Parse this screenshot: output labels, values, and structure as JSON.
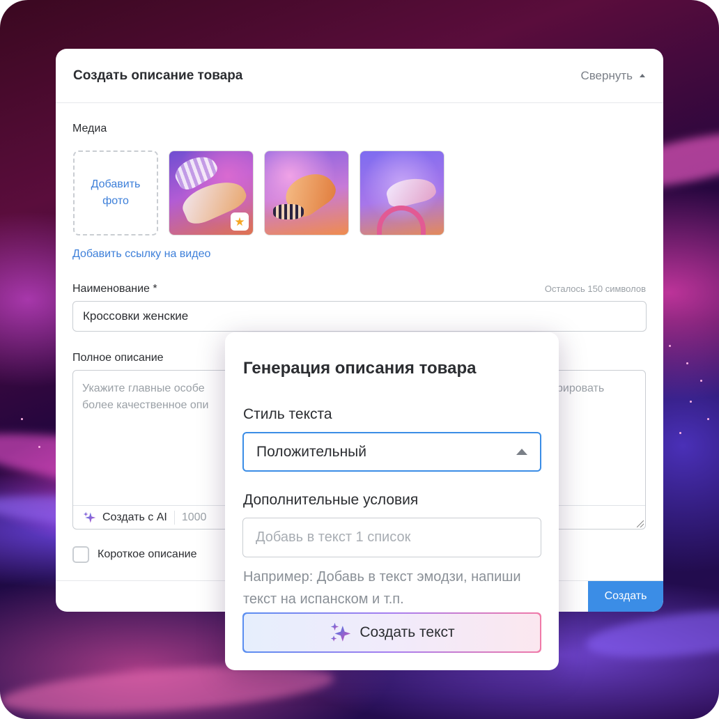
{
  "card": {
    "title": "Создать описание товара",
    "collapse_label": "Свернуть"
  },
  "media": {
    "label": "Медиа",
    "add_photo": "Добавить фото",
    "add_video_link": "Добавить ссылку на видео"
  },
  "name_field": {
    "label": "Наименование *",
    "counter": "Осталось 150 символов",
    "value": "Кроссовки женские"
  },
  "description": {
    "label": "Полное описание",
    "placeholder": "Укажите главные особе",
    "placeholder_line2": "более качественное опи",
    "placeholder_tail": "рировать",
    "ai_button": "Создать с AI",
    "char_count": "1000"
  },
  "short_description": {
    "label": "Короткое описание"
  },
  "submit_label": "Создать",
  "popup": {
    "title": "Генерация описания товара",
    "style_label": "Стиль текста",
    "style_value": "Положительный",
    "conditions_label": "Дополнительные условия",
    "conditions_placeholder": "Добавь в текст 1 список",
    "hint": "Например: Добавь в текст эмодзи, напиши текст на испанском и т.п.",
    "generate_button": "Создать текст"
  },
  "colors": {
    "accent": "#3b8de6",
    "link": "#3d7fd9",
    "badge_star": "#f5a623"
  }
}
